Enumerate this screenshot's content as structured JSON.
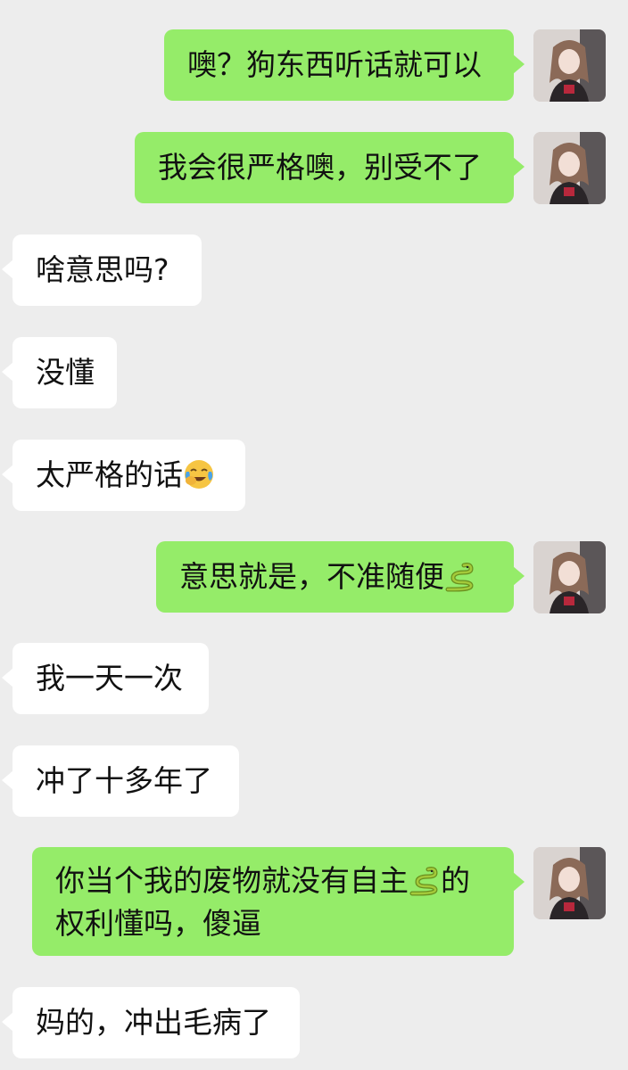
{
  "messages": [
    {
      "side": "out",
      "text": "噢？狗东西听话就可以"
    },
    {
      "side": "out",
      "text": "我会很严格噢，别受不了"
    },
    {
      "side": "in",
      "text": "啥意思吗?"
    },
    {
      "side": "in",
      "text": "没懂"
    },
    {
      "side": "in",
      "text": "太严格的话",
      "emoji": "face-with-tears-of-joy-emoji"
    },
    {
      "side": "out",
      "text": "意思就是，不准随便",
      "emoji": "snake-emoji"
    },
    {
      "side": "in",
      "text": "我一天一次"
    },
    {
      "side": "in",
      "text": "冲了十多年了"
    },
    {
      "side": "out",
      "text_part1": "你当个我的废物就没有自主",
      "emoji": "snake-emoji",
      "text_part2": "的",
      "text_line2": "权利懂吗，傻逼"
    },
    {
      "side": "in",
      "text": "妈的，冲出毛病了"
    }
  ],
  "colors": {
    "background": "#ededed",
    "outgoing_bubble": "#95ec69",
    "incoming_bubble": "#ffffff"
  }
}
